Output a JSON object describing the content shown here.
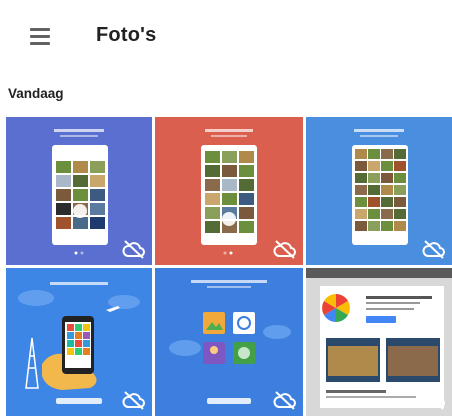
{
  "app": {
    "title": "Foto's",
    "menu_icon": "hamburger-menu-icon"
  },
  "section": {
    "label": "Vandaag"
  },
  "tiles": [
    {
      "bg": "#5b6fd1",
      "status_icon": "cloud-off-icon"
    },
    {
      "bg": "#db5f4e",
      "status_icon": "cloud-off-icon"
    },
    {
      "bg": "#4a8ee0",
      "status_icon": "cloud-off-icon"
    },
    {
      "bg": "#3e86e6",
      "status_icon": "cloud-off-icon"
    },
    {
      "bg": "#3c7fdf",
      "status_icon": "cloud-off-icon"
    },
    {
      "bg": "#e7e7e7",
      "status_icon": "cloud-off-icon"
    }
  ],
  "colors": {
    "text_primary": "#212121",
    "icon_grey": "#616161"
  }
}
